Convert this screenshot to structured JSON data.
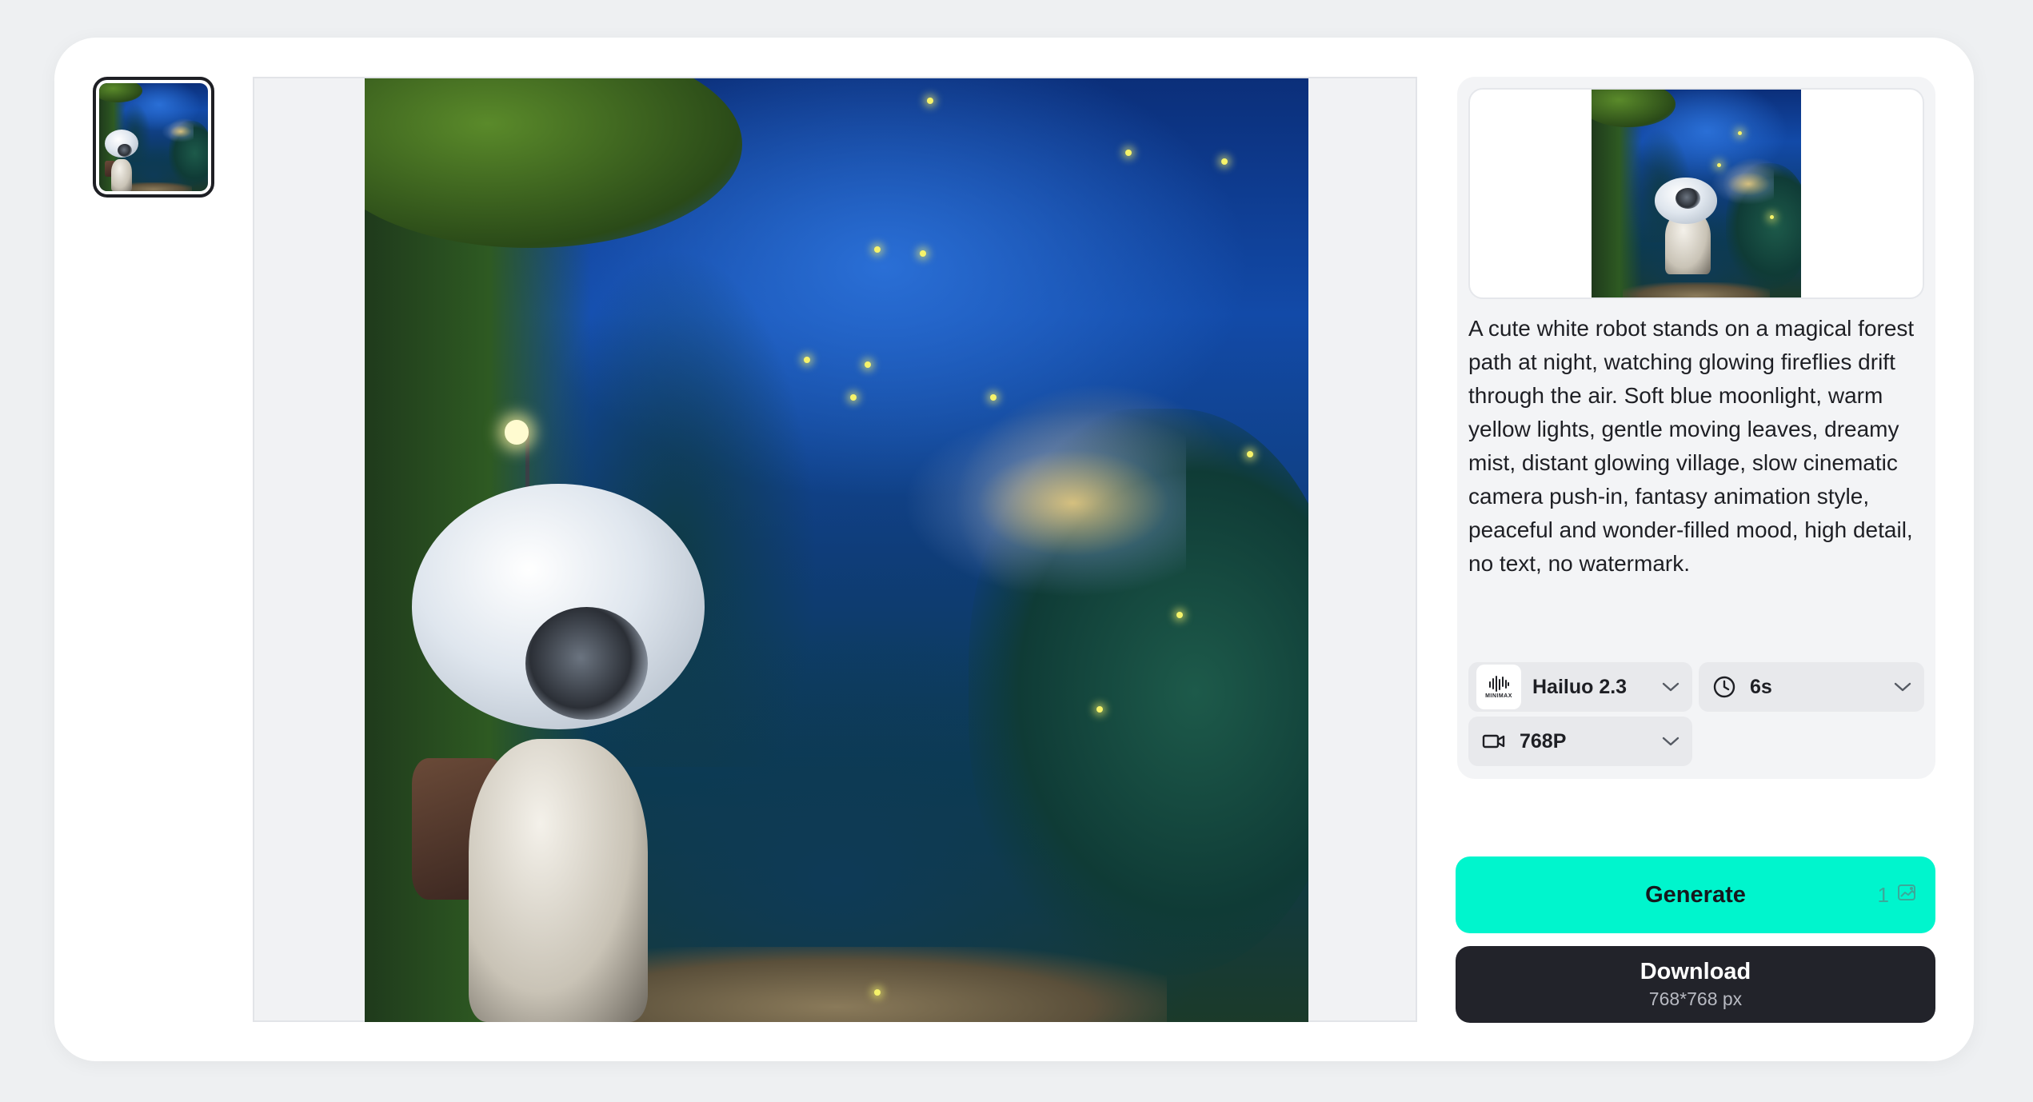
{
  "history": {
    "thumbnail_alt": "Generated thumbnail"
  },
  "preview": {
    "prompt": "A cute white robot stands on a magical forest path at night, watching glowing fireflies drift through the air. Soft blue moonlight, warm yellow lights, gentle moving leaves, dreamy mist, distant glowing village, slow cinematic camera push-in, fantasy animation style, peaceful and wonder-filled mood, high detail, no text, no watermark."
  },
  "settings": {
    "model": {
      "label": "Hailuo 2.3",
      "logo_text": "MINIMAX",
      "icon": "minimax-logo-icon"
    },
    "duration": {
      "label": "6s",
      "icon": "clock-icon"
    },
    "resolution": {
      "label": "768P",
      "icon": "video-camera-icon"
    }
  },
  "actions": {
    "generate_label": "Generate",
    "generate_cost": "1",
    "cost_icon": "credit-image-icon",
    "download_label": "Download",
    "download_size": "768*768 px"
  },
  "colors": {
    "generate_bg": "#00f5cd",
    "download_bg": "#22232a",
    "page_bg": "#eef0f2"
  }
}
